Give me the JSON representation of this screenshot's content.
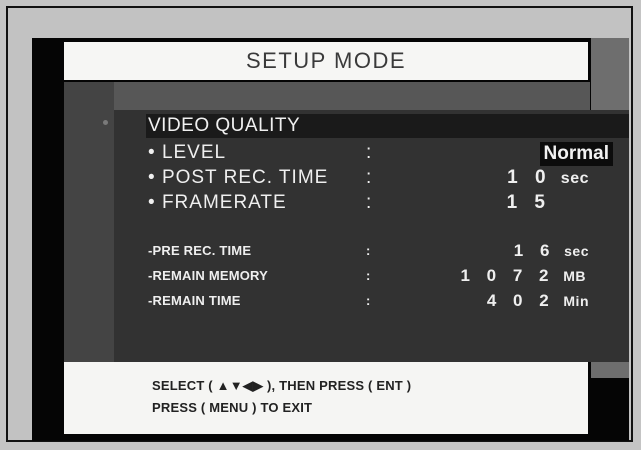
{
  "title": "SETUP MODE",
  "section": {
    "title": "VIDEO QUALITY",
    "settings": [
      {
        "label": "LEVEL",
        "colon": ":",
        "value": "Normal"
      },
      {
        "label": "POST REC. TIME",
        "colon": ":",
        "value": "1 0",
        "unit": "sec"
      },
      {
        "label": "FRAMERATE",
        "colon": ":",
        "value": "1 5"
      }
    ],
    "info": [
      {
        "label": "PRE REC. TIME",
        "colon": ":",
        "value": "1 6",
        "unit": "sec"
      },
      {
        "label": "REMAIN MEMORY",
        "colon": ":",
        "value": "1 0 7 2",
        "unit": "MB"
      },
      {
        "label": "REMAIN TIME",
        "colon": ":",
        "value": "4 0 2",
        "unit": "Min"
      }
    ]
  },
  "footer": {
    "line1": "SELECT ( ▲▼◀▶ ), THEN PRESS ( ENT )",
    "line2": "PRESS ( MENU ) TO EXIT"
  },
  "bullets": {
    "big": "•",
    "small": "-"
  },
  "colors": {
    "panel": "#323232",
    "title_bg": "#f6f6f4",
    "screen_bg": "#050505"
  }
}
